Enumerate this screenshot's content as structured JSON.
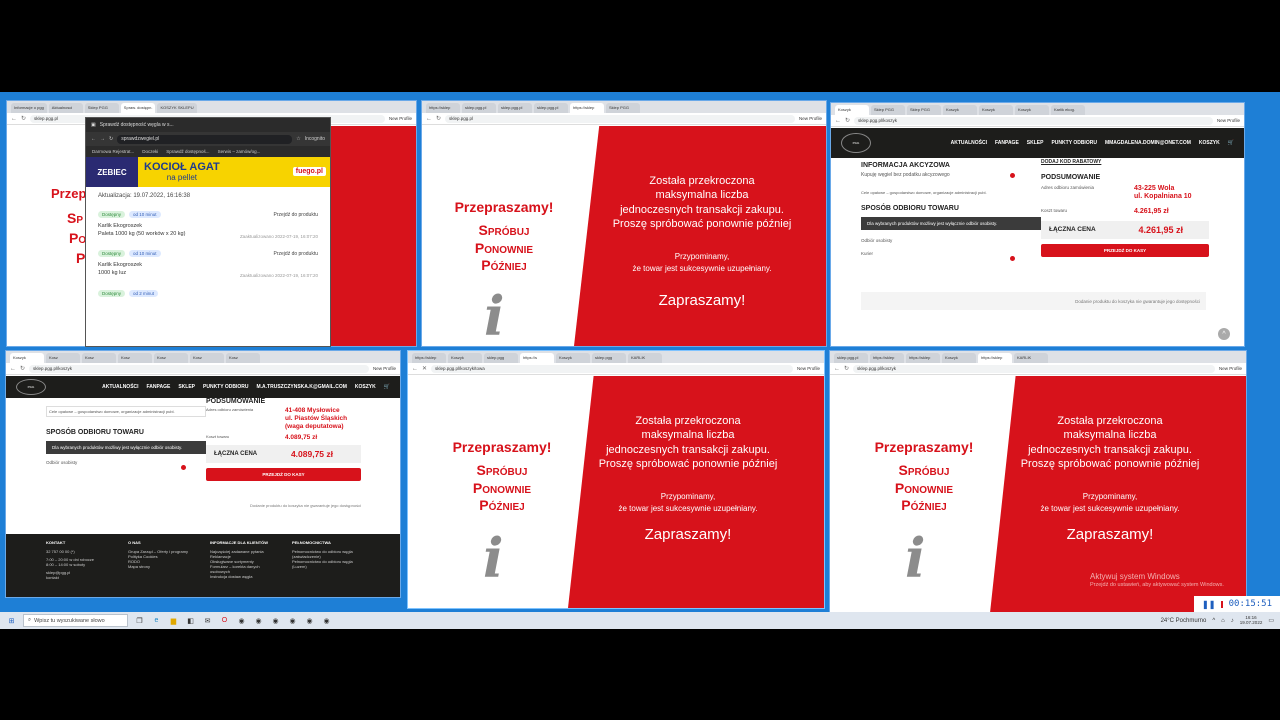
{
  "browser": {
    "new_profile": "New Profile",
    "urls": {
      "w1": "sklep.pgg.pl",
      "w2": "sklep.pgg.pl",
      "w3": "sklep.pgg.pl/koszyk",
      "w4": "sklep.pgg.pl/koszyk",
      "w5": "sklep.pgg.pl/koszyk/towa",
      "w6": "sklep.pgg.pl/koszyk"
    },
    "tabs_w1": [
      "Informacje o pgg",
      "Aktualnosci",
      "Sklep PGG",
      "Spraw. dostępn.",
      "KOSZYK SKLEPU"
    ],
    "tabs_w2": [
      "https://sklep",
      "sklep.pgg.pl",
      "sklep.pgg.pl",
      "sklep.pgg.pl",
      "https://sklep",
      "Sklep PGG"
    ],
    "tabs_w3": [
      "Koszyk",
      "Sklep PGG",
      "Sklep PGG",
      "Koszyk",
      "Koszyk",
      "Koszyk",
      "Karlik ekog."
    ],
    "tabs_w4": [
      "Koszyk",
      "Kosz",
      "Kosz",
      "Kosz",
      "Kosz",
      "Kosz",
      "Kosz"
    ],
    "tabs_w5": [
      "https://sklep",
      "Koszyk",
      "sklep.pgg",
      "https://s",
      "Koszyk",
      "sklep.pgg",
      "KARLIK"
    ],
    "tabs_w6": [
      "sklep.pgg.pl",
      "https://sklep",
      "https://sklep",
      "Koszyk",
      "https://sklep",
      "KARLIK"
    ]
  },
  "error_page": {
    "sorry": "Przepraszamy!",
    "retry_line1": "Spróbuj",
    "retry_line2": "Ponownie",
    "retry_line3": "Później",
    "msg_line1": "Została przekroczona",
    "msg_line2": "maksymalna liczba",
    "msg_line3": "jednoczesnych transakcji zakupu.",
    "msg_line4": "Proszę spróbować ponownie później",
    "remind_line1": "Przypominamy,",
    "remind_line2": "że towar jest sukcesywnie uzupełniany.",
    "welcome": "Zapraszamy!",
    "info_glyph": "i",
    "partial_sorry": "Przepr",
    "partial_retry1": "Sp",
    "partial_retry2": "Po",
    "partial_retry3": "P"
  },
  "windows_activation": {
    "line1": "Aktywuj system Windows",
    "line2": "Przejdź do ustawień, aby aktywować system Windows."
  },
  "popup": {
    "title_tab": "Sprawdź dostępność węgla w s...",
    "url": "sprawdzwegiel.pl",
    "profile": "Incognito",
    "bookmarks": [
      "Darmowa Rejestrat...",
      "Doczeki",
      "Sprawdź dostępnoś...",
      "Serwis – zamów/og..."
    ],
    "banner_brand": "ZEBIEC",
    "banner_title": "KOCIOŁ AGAT",
    "banner_subtitle": "na pellet",
    "banner_site": "fuego.pl",
    "updated": "Aktualizacja: 19.07.2022, 16:16:38",
    "entries": [
      {
        "status": "Dostępny",
        "since": "od 10 minut",
        "goto": "Przejdź do produktu",
        "brand": "Karlik Ekogroszek",
        "name": "Paleta 1000 kg (50 worków x 20 kg)",
        "updated": "Zaaktualizowano 2022-07-19, 16:07:20"
      },
      {
        "status": "Dostępny",
        "since": "od 10 minut",
        "goto": "Przejdź do produktu",
        "brand": "Karlik Ekogroszek",
        "name": "1000 kg luz",
        "updated": "Zaaktualizowano 2022-07-19, 16:07:20"
      },
      {
        "status": "Dostępny",
        "since": "od 2 minut",
        "goto": "",
        "brand": "",
        "name": "",
        "updated": ""
      }
    ]
  },
  "shop_w3": {
    "nav": [
      "AKTUALNOŚCI",
      "FANPAGE",
      "SKLEP",
      "PUNKTY ODBIORU",
      "MMAGDALENA.DOMIN@ONET.COM",
      "KOSZYK"
    ],
    "excise_title": "INFORMACJA AKCYZOWA",
    "excise_line": "Kupuję węgiel bez podatku akcyzowego",
    "purpose_line": "Cele opałowe – gospodarstwo domowe, organizacje administracji publ.",
    "pickup_title": "SPOSÓB ODBIORU TOWARU",
    "pickup_warning": "Dla wybranych produktów możliwy jest wyłącznie odbiór osobisty.",
    "pickup_personal": "Odbiór osobisty",
    "pickup_courier": "Kurier",
    "discount_link": "DODAJ KOD RABATOWY",
    "summary_title": "PODSUMOWANIE",
    "address_label": "Adres odbioru zamówienia",
    "address_value_1": "43-225 Wola",
    "address_value_2": "ul. Kopalniana 10",
    "goods_cost_label": "Koszt towaru",
    "goods_cost": "4.261,95 zł",
    "total_label": "ŁĄCZNA CENA",
    "total": "4.261,95 zł",
    "checkout": "PRZEJDŹ DO KASY",
    "notice": "Dodanie produktu do koszyka nie gwarantuje jego dostępności"
  },
  "shop_w4": {
    "nav": [
      "AKTUALNOŚCI",
      "FANPAGE",
      "SKLEP",
      "PUNKTY ODBIORU",
      "M.A.TRUSZCZYNSKA.K@GMAIL.COM",
      "KOSZYK"
    ],
    "summary_title": "PODSUMOWANIE",
    "purpose_line": "Cele opałowe – gospodarstwo domowe, organizacje administracji publ.",
    "address_label": "Adres odbioru zamówienia",
    "address_value_1": "41-408 Mysłowice",
    "address_value_2": "ul. Piastów Śląskich",
    "address_value_3": "(waga deputatowa)",
    "pickup_title": "SPOSÓB ODBIORU TOWARU",
    "pickup_warning": "Dla wybranych produktów możliwy jest wyłącznie odbiór osobisty.",
    "pickup_personal": "Odbiór osobisty",
    "goods_cost_label": "Koszt towaru",
    "goods_cost": "4.089,75 zł",
    "total_label": "ŁĄCZNA CENA",
    "total": "4.089,75 zł",
    "checkout": "PRZEJDŹ DO KASY",
    "notice": "Dodanie produktu do koszyka nie gwarantuje jego dostępności",
    "footer": {
      "contact_title": "KONTAKT",
      "contact_phone": "32 757 00 00 (*)",
      "contact_hours_1": "7:00 – 20:00 w dni robocze",
      "contact_hours_2": "8:00 – 14:00 w soboty",
      "contact_email": "sklep@pgg.pl",
      "contact_form": "kontakt",
      "about_title": "O NAS",
      "about_items": [
        "Grupa Zarząd – Oferty i programy",
        "Polityka Cookies",
        "RODO",
        "Mapa strony"
      ],
      "clients_title": "INFORMACJE DLA KLIENTÓW",
      "clients_items": [
        "Najczęściej zadawane pytania",
        "Reklamacje",
        "Obsługiwane sortymenty",
        "Formularz – korekta danych osobowych",
        "Instrukcja dostaw węgla"
      ],
      "proxy_title": "PEŁNOMOCNICTWA",
      "proxy_items": [
        "Pełnomocnictwo do odbioru węgla (zaświadczenie)",
        "Pełnomocnictwo do odbioru węgla (Luzem)"
      ]
    }
  },
  "taskbar": {
    "search_placeholder": "Wpisz tu wyszukiwane słowo",
    "weather": "24°C Pochmurno",
    "time": "16:16",
    "date": "19.07.2022"
  },
  "recorder": {
    "time": "00:15:51"
  },
  "colors": {
    "brand_red": "#d7121b",
    "desktop_blue": "#1e7fd6",
    "shop_dark": "#1d1d1b"
  }
}
